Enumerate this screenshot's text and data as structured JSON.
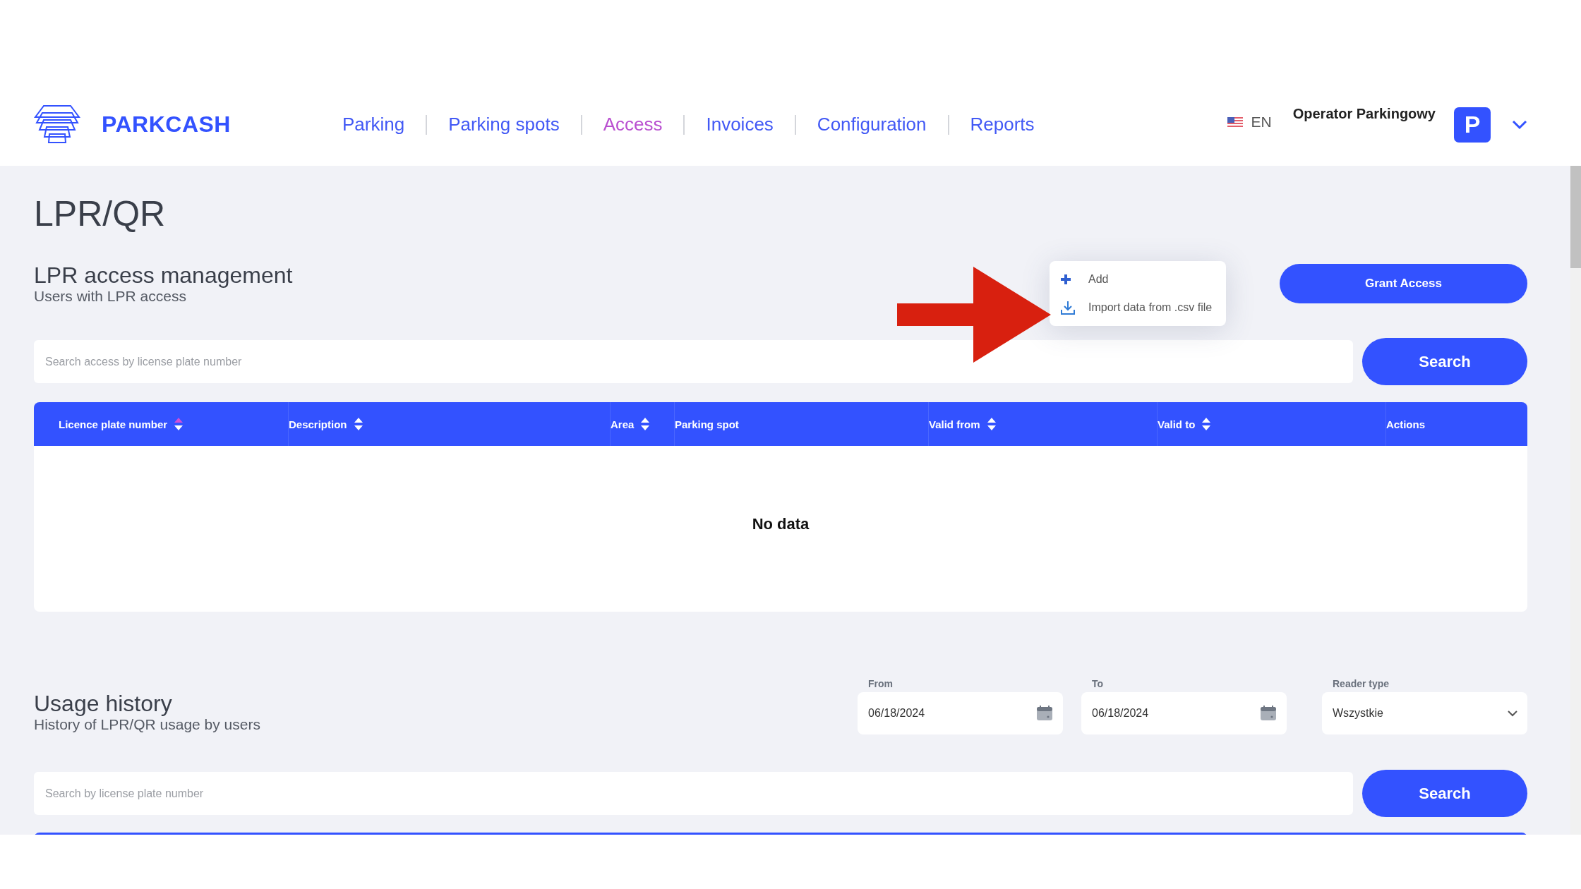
{
  "header": {
    "brand": "PARKCASH",
    "nav": [
      {
        "label": "Parking",
        "selected": false
      },
      {
        "label": "Parking spots",
        "selected": false
      },
      {
        "label": "Access",
        "selected": true
      },
      {
        "label": "Invoices",
        "selected": false
      },
      {
        "label": "Configuration",
        "selected": false
      },
      {
        "label": "Reports",
        "selected": false
      }
    ],
    "language": "EN",
    "user": "Operator Parkingowy",
    "avatar": "P"
  },
  "page_title": "LPR/QR",
  "lpr_section": {
    "title": "LPR access management",
    "subtitle": "Users with LPR access",
    "grant_button": "Grant Access",
    "menu": [
      {
        "kind": "add",
        "label": "Add"
      },
      {
        "kind": "import",
        "label": "Import data from .csv file"
      }
    ],
    "search": {
      "placeholder": "Search access by license plate number",
      "button": "Search"
    },
    "table": {
      "columns": [
        {
          "label": "Licence plate number",
          "sorted": true
        },
        {
          "label": "Description",
          "sorted": false
        },
        {
          "label": "Area",
          "sorted": false
        },
        {
          "label": "Parking spot"
        },
        {
          "label": "Valid from",
          "sorted": false
        },
        {
          "label": "Valid to",
          "sorted": false
        },
        {
          "label": "Actions"
        }
      ],
      "empty": "No data"
    }
  },
  "usage_section": {
    "title": "Usage history",
    "subtitle": "History of LPR/QR usage by users",
    "filters": [
      {
        "kind": "date",
        "label": "From",
        "value": "06/18/2024"
      },
      {
        "kind": "date",
        "label": "To",
        "value": "06/18/2024"
      },
      {
        "kind": "select",
        "label": "Reader type",
        "value": "Wszystkie"
      }
    ],
    "search": {
      "placeholder": "Search by license plate number",
      "button": "Search"
    }
  }
}
